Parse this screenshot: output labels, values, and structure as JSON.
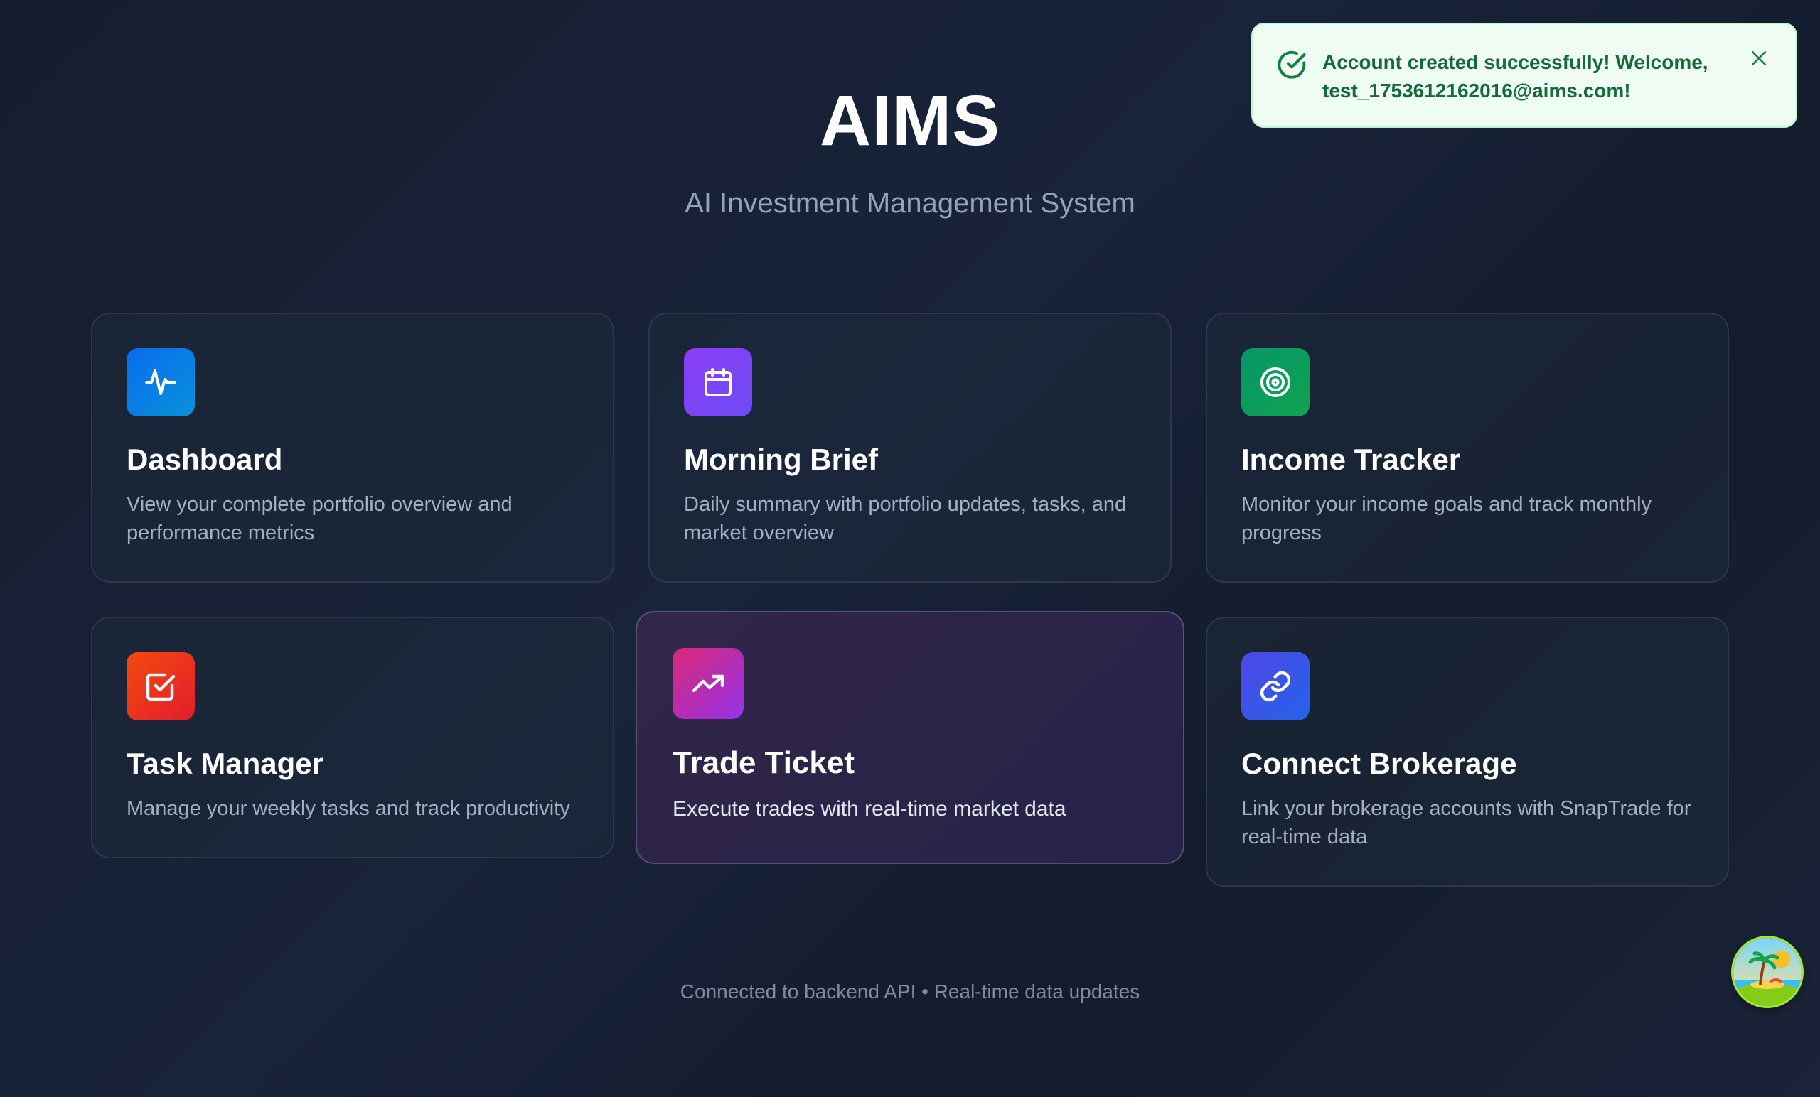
{
  "header": {
    "title": "AIMS",
    "subtitle": "AI Investment Management System"
  },
  "toast": {
    "message": "Account created successfully! Welcome, test_1753612162016@aims.com!",
    "icon": "check-circle-icon",
    "close_icon": "close-icon",
    "background": "#f0fdf4",
    "text_color": "#15693a"
  },
  "cards": [
    {
      "title": "Dashboard",
      "description": "View your complete portfolio overview and performance metrics",
      "icon": "activity-icon",
      "colors": [
        "#0a6cf0",
        "#0891d8"
      ]
    },
    {
      "title": "Morning Brief",
      "description": "Daily summary with portfolio updates, tasks, and market overview",
      "icon": "calendar-icon",
      "colors": [
        "#7c3aed",
        "#6d4cf5"
      ]
    },
    {
      "title": "Income Tracker",
      "description": "Monitor your income goals and track monthly progress",
      "icon": "target-icon",
      "colors": [
        "#059669",
        "#10a34e"
      ]
    },
    {
      "title": "Task Manager",
      "description": "Manage your weekly tasks and track productivity",
      "icon": "check-square-icon",
      "colors": [
        "#f43f0e",
        "#e11d2e"
      ]
    },
    {
      "title": "Trade Ticket",
      "description": "Execute trades with real-time market data",
      "icon": "trending-up-icon",
      "colors": [
        "#db2777",
        "#9333ea"
      ]
    },
    {
      "title": "Connect Brokerage",
      "description": "Link your brokerage accounts with SnapTrade for real-time data",
      "icon": "link-icon",
      "colors": [
        "#4f46e5",
        "#2563eb"
      ]
    }
  ],
  "footer": {
    "status": "Connected to backend API • Real-time data updates"
  },
  "avatar": {
    "icon": "beach-avatar-icon"
  }
}
